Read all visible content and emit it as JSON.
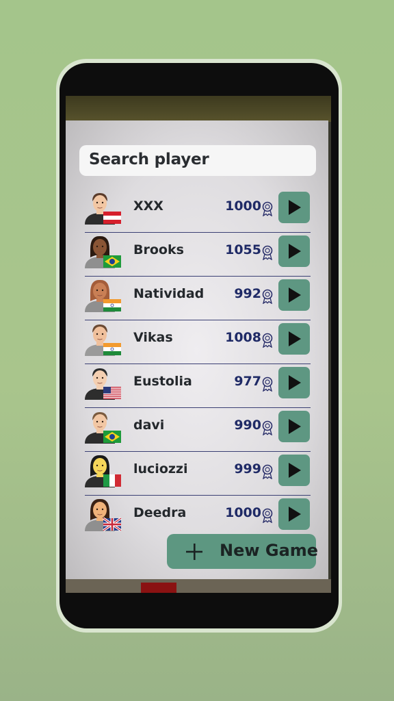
{
  "search": {
    "label": "Search player"
  },
  "players": [
    {
      "name": "XXX",
      "score": "1000",
      "flag": "austria",
      "skin": "#f2c7a4",
      "hair": "#5a3b2a",
      "shirt": "#2d2d2d"
    },
    {
      "name": "Brooks",
      "score": "1055",
      "flag": "brazil",
      "skin": "#8a5535",
      "hair": "#2b1a10",
      "shirt": "#8f8f8f"
    },
    {
      "name": "Natividad",
      "score": "992",
      "flag": "india",
      "skin": "#c97f55",
      "hair": "#a45d3a",
      "shirt": "#8f8f8f"
    },
    {
      "name": "Vikas",
      "score": "1008",
      "flag": "india",
      "skin": "#f0c09c",
      "hair": "#6b4a33",
      "shirt": "#9a9a9a"
    },
    {
      "name": "Eustolia",
      "score": "977",
      "flag": "usa",
      "skin": "#f4cfb1",
      "hair": "#2b2b2b",
      "shirt": "#2d2d2d"
    },
    {
      "name": "davi",
      "score": "990",
      "flag": "brazil",
      "skin": "#f2c7a4",
      "hair": "#7a5a3e",
      "shirt": "#2d2d2d"
    },
    {
      "name": "luciozzi",
      "score": "999",
      "flag": "italy",
      "skin": "#f6d65a",
      "hair": "#1a1a1a",
      "shirt": "#2d2d2d"
    },
    {
      "name": "Deedra",
      "score": "1000",
      "flag": "uk",
      "skin": "#f0b27a",
      "hair": "#3a2114",
      "shirt": "#8f8f8f"
    }
  ],
  "new_game": {
    "label": "New Game"
  },
  "colors": {
    "accent": "#5e9782",
    "score": "#1f2a66",
    "divider": "#3a3f73"
  }
}
